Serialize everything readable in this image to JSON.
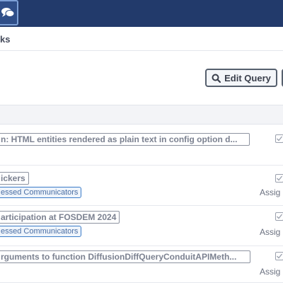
{
  "crumbs": {
    "current": "ks"
  },
  "header": {
    "edit_query_label": "Edit Query"
  },
  "icons": {
    "chat": "chat-icon",
    "search": "search-icon",
    "check": "checkbox-icon"
  },
  "colors": {
    "topbar": "#223a6b",
    "tag_border": "#3a7bc8"
  },
  "rows": [
    {
      "title": "n: HTML entities rendered as plain text in config option d...",
      "tag": "",
      "assign": ""
    },
    {
      "title": "ickers",
      "tag": "essed Communicators",
      "assign": "Assig"
    },
    {
      "title": "articipation at FOSDEM 2024",
      "tag": "essed Communicators",
      "assign": "Assig"
    },
    {
      "title": "rguments to function DiffusionDiffQueryConduitAPIMeth...",
      "tag": "",
      "assign": "Assig"
    }
  ]
}
